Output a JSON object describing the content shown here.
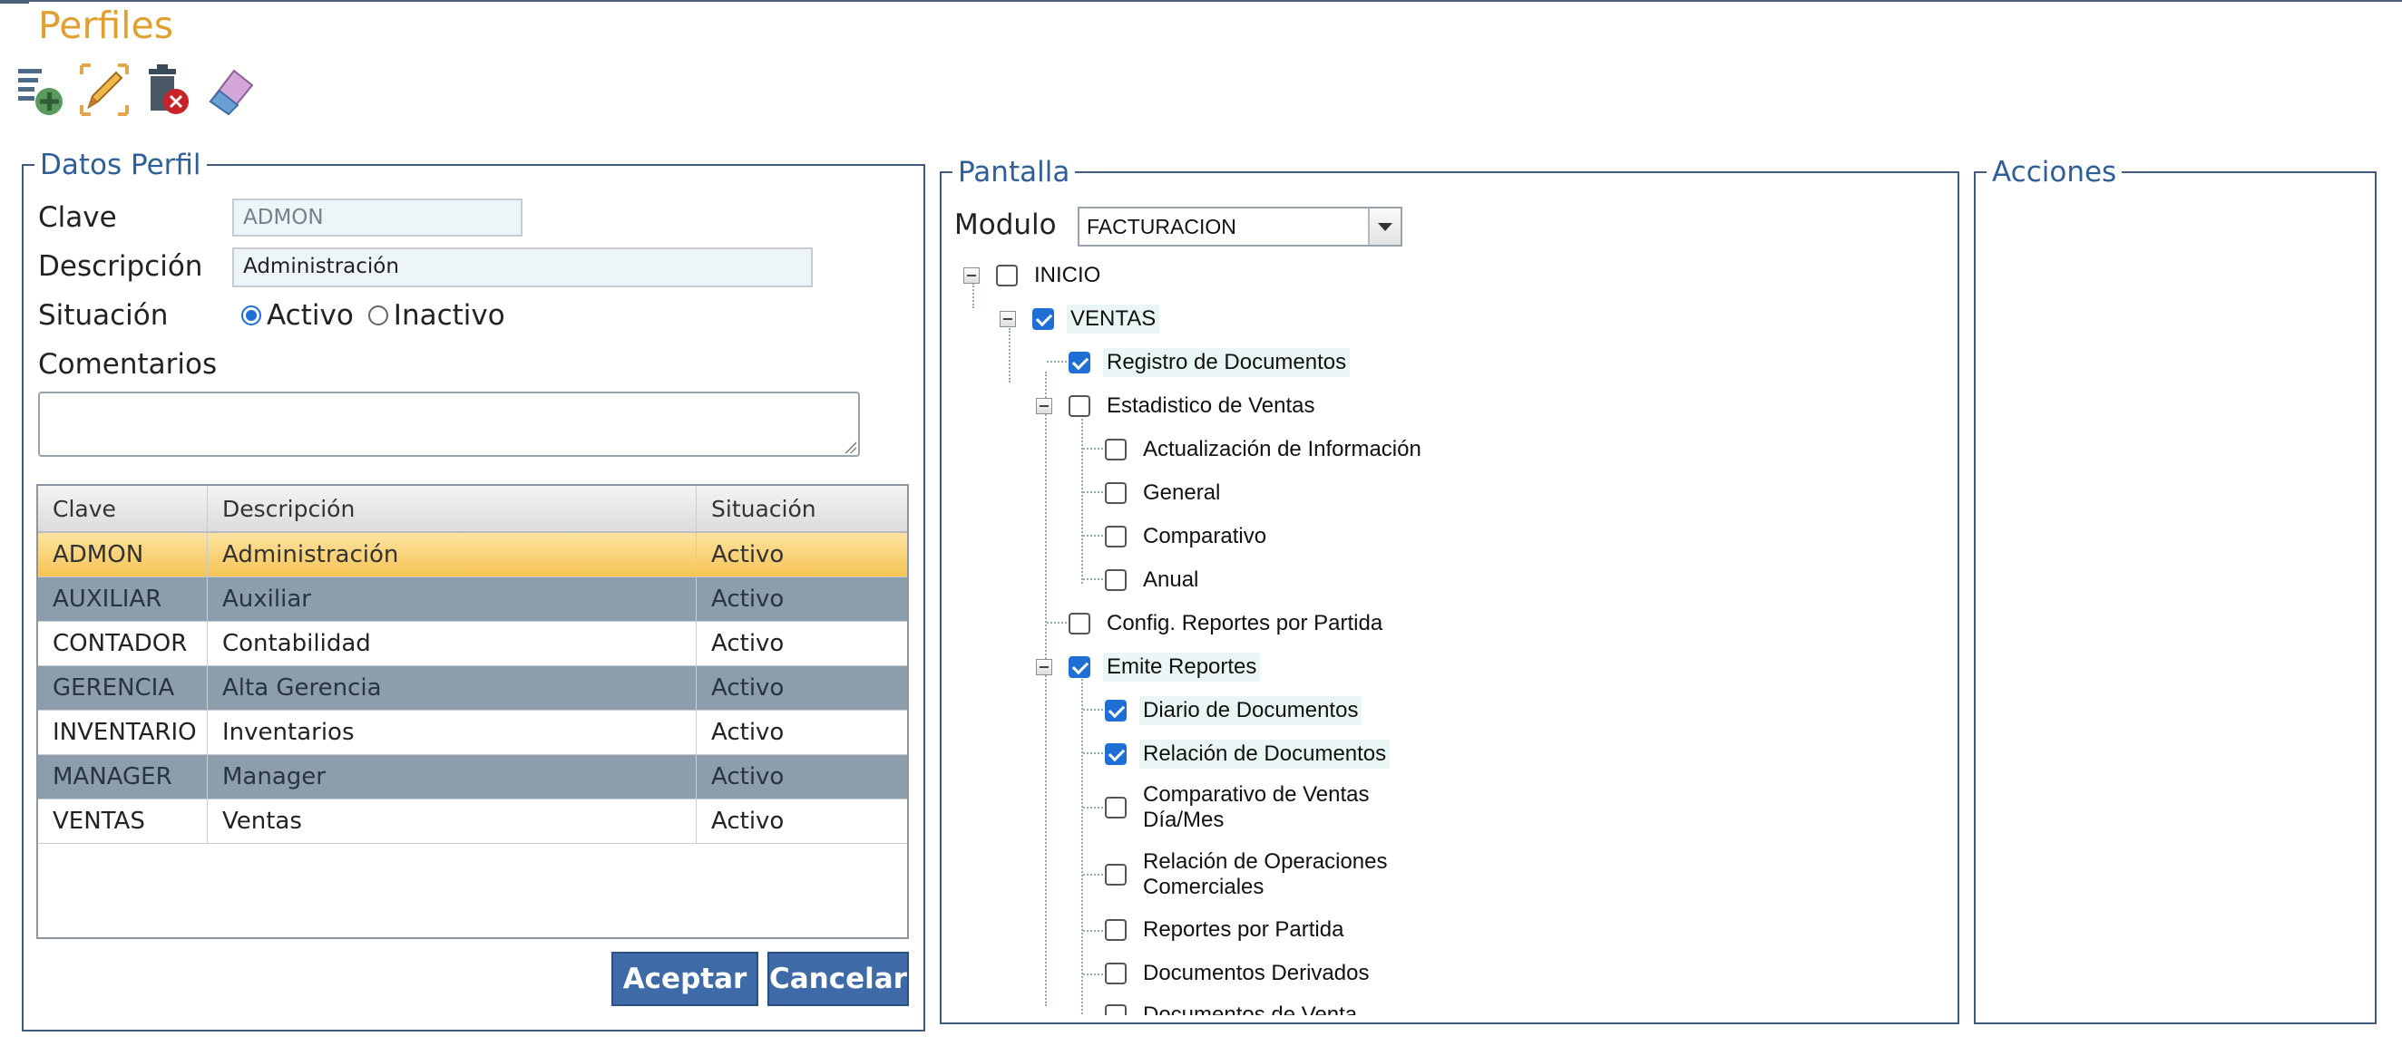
{
  "page": {
    "title": "Perfiles"
  },
  "toolbar": {
    "new_icon": "document-add-icon",
    "edit_icon": "pencil-edit-icon",
    "delete_icon": "trash-delete-icon",
    "clear_icon": "eraser-icon"
  },
  "datos": {
    "legend": "Datos Perfil",
    "clave_label": "Clave",
    "clave_value": "ADMON",
    "descripcion_label": "Descripción",
    "descripcion_value": "Administración",
    "situacion_label": "Situación",
    "activo_label": "Activo",
    "inactivo_label": "Inactivo",
    "situacion_selected": "Activo",
    "comentarios_label": "Comentarios",
    "comentarios_value": ""
  },
  "table": {
    "columns": [
      "Clave",
      "Descripción",
      "Situación"
    ],
    "rows": [
      [
        "ADMON",
        "Administración",
        "Activo"
      ],
      [
        "AUXILIAR",
        "Auxiliar",
        "Activo"
      ],
      [
        "CONTADOR",
        "Contabilidad",
        "Activo"
      ],
      [
        "GERENCIA",
        "Alta Gerencia",
        "Activo"
      ],
      [
        "INVENTARIO",
        "Inventarios",
        "Activo"
      ],
      [
        "MANAGER",
        "Manager",
        "Activo"
      ],
      [
        "VENTAS",
        "Ventas",
        "Activo"
      ]
    ],
    "selected_row": 0
  },
  "buttons": {
    "aceptar": "Aceptar",
    "cancelar": "Cancelar"
  },
  "pantalla": {
    "legend": "Pantalla",
    "modulo_label": "Modulo",
    "modulo_value": "FACTURACION",
    "tree": [
      "INICIO",
      "VENTAS",
      "Registro de Documentos",
      "Estadistico de Ventas",
      "Actualización de Información",
      "General",
      "Comparativo",
      "Anual",
      "Config. Reportes por Partida",
      "Emite Reportes",
      "Diario de Documentos",
      "Relación de Documentos",
      "Comparativo de Ventas Día/Mes",
      "Relación de Operaciones Comerciales",
      "Reportes por Partida",
      "Documentos Derivados",
      "Documentos de Venta"
    ],
    "tree_checked": [
      false,
      true,
      true,
      false,
      false,
      false,
      false,
      false,
      false,
      true,
      true,
      true,
      false,
      false,
      false,
      false,
      false
    ]
  },
  "acciones": {
    "legend": "Acciones"
  },
  "colors": {
    "title": "#e0a030",
    "legend": "#2f5f9b",
    "button": "#3f6aa8",
    "selected_row": "#f6c454",
    "alt_row": "#8c9dab",
    "check": "#1f6fd6"
  }
}
